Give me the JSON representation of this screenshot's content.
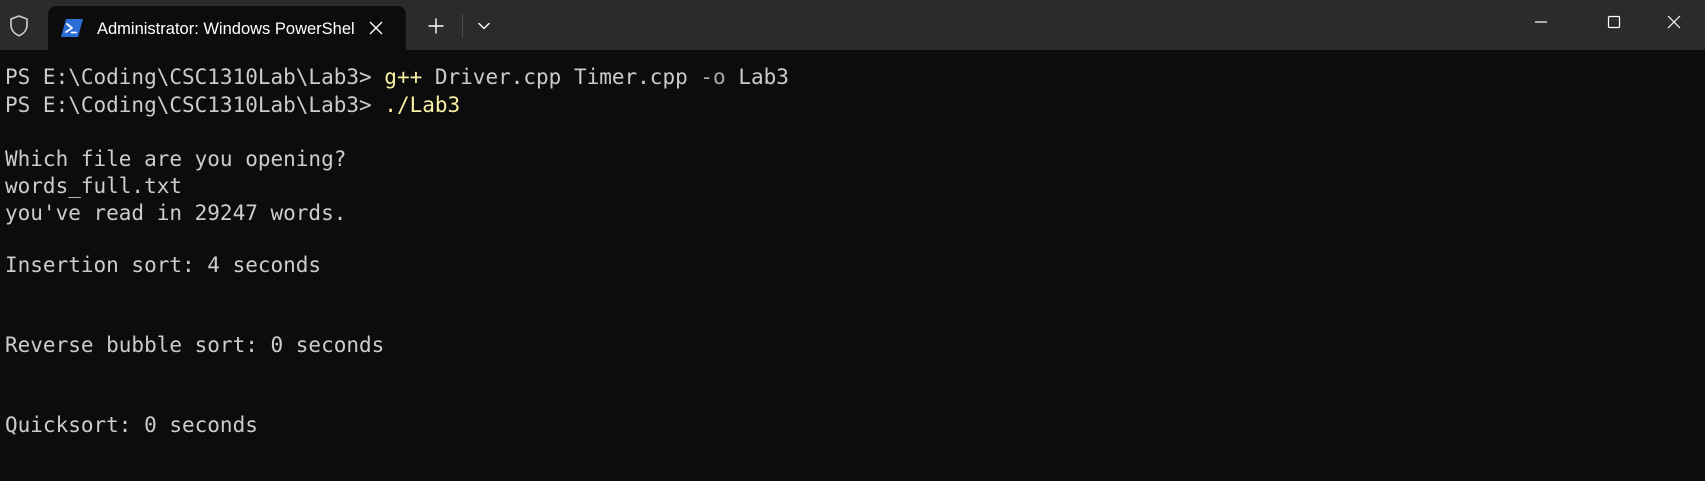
{
  "window": {
    "tab_title": "Administrator: Windows PowerShell",
    "tab_icon": "powershell-icon",
    "colors": {
      "background": "#0c0c0c",
      "titlebar": "#2b2b2b",
      "text": "#cccccc",
      "command": "#f9f1a5",
      "parameter": "#a8a8a8",
      "powershell_blue": "#2a6fd6"
    }
  },
  "terminal": {
    "lines": [
      {
        "prompt": "PS E:\\Coding\\CSC1310Lab\\Lab3> ",
        "command": "g++",
        "args": " Driver.cpp Timer.cpp ",
        "flag": "-o",
        "tail": " Lab3"
      },
      {
        "prompt": "PS E:\\Coding\\CSC1310Lab\\Lab3> ",
        "command": "./Lab3"
      },
      {
        "text": "Which file are you opening?"
      },
      {
        "text": "words_full.txt"
      },
      {
        "text": "you've read in 29247 words."
      },
      {
        "text": "Insertion sort: 4 seconds"
      },
      {
        "text": "Reverse bubble sort: 0 seconds"
      },
      {
        "text": "Quicksort: 0 seconds"
      }
    ]
  }
}
